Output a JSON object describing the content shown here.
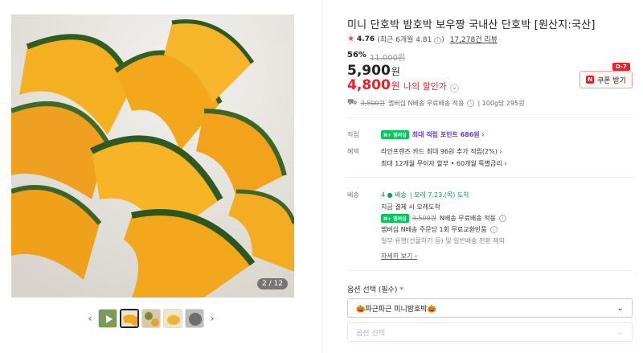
{
  "gallery": {
    "counter": "2 / 12",
    "thumb_count": 6,
    "active_thumb": 2
  },
  "product": {
    "title": "미니 단호박 밤호박 보우짱 국내산 단호박 [원산지:국산]",
    "rating": "4.76",
    "rating_note": "(최근 6개월 4.81",
    "rating_note_close": ")",
    "reviews": "17,278건 리뷰",
    "discount_pct": "56%",
    "original_price": "11,000원",
    "price": "5,900",
    "price_unit": "원",
    "my_price": "4,800",
    "my_price_unit": "원",
    "my_price_label": "나의 할인가",
    "coupon_badge": "D-7",
    "coupon_label": "쿠폰 받기",
    "coupon_n": "N",
    "shipping_fee": "3,500원",
    "shipping_text": "멤버십 N배송 무료배송 적용",
    "unit_price": "| 100g당 295원"
  },
  "points": {
    "label": "적립",
    "npay": "N+ 멤버십",
    "text": "최대 적립 포인트 686원 ›"
  },
  "benefits": {
    "label": "혜택",
    "line1": "라인프렌즈 카드 최대 96원 추가 적립(2%) ›",
    "line2": "최대 12개월 무이자 할부 • 60개월 특별금리 ›"
  },
  "delivery": {
    "label": "배송",
    "badge": "4 ● 배송",
    "arrival": "| 모레 7.23.(목) 도착",
    "line2": "지금 결제 시 모레도착",
    "npay": "N+ 멤버십",
    "fee": "3,500원",
    "free_text": "N배송 무료배송 적용",
    "line4": "멤버십 N배송 주문당 1회 무료교환반품",
    "line5": "일부 유형(선물하기 등) 및 일반배송 전환 제외",
    "details": "자세히 보기 ›"
  },
  "options": {
    "label": "옵션 선택 (필수)",
    "required_mark": "*",
    "selected": "🎃파근파근 미니밤호박🎃",
    "placeholder": "옵션 선택"
  },
  "colors": {
    "accent_red": "#e8212b",
    "naver_green": "#03c75a",
    "points_purple": "#6a3ccf"
  }
}
